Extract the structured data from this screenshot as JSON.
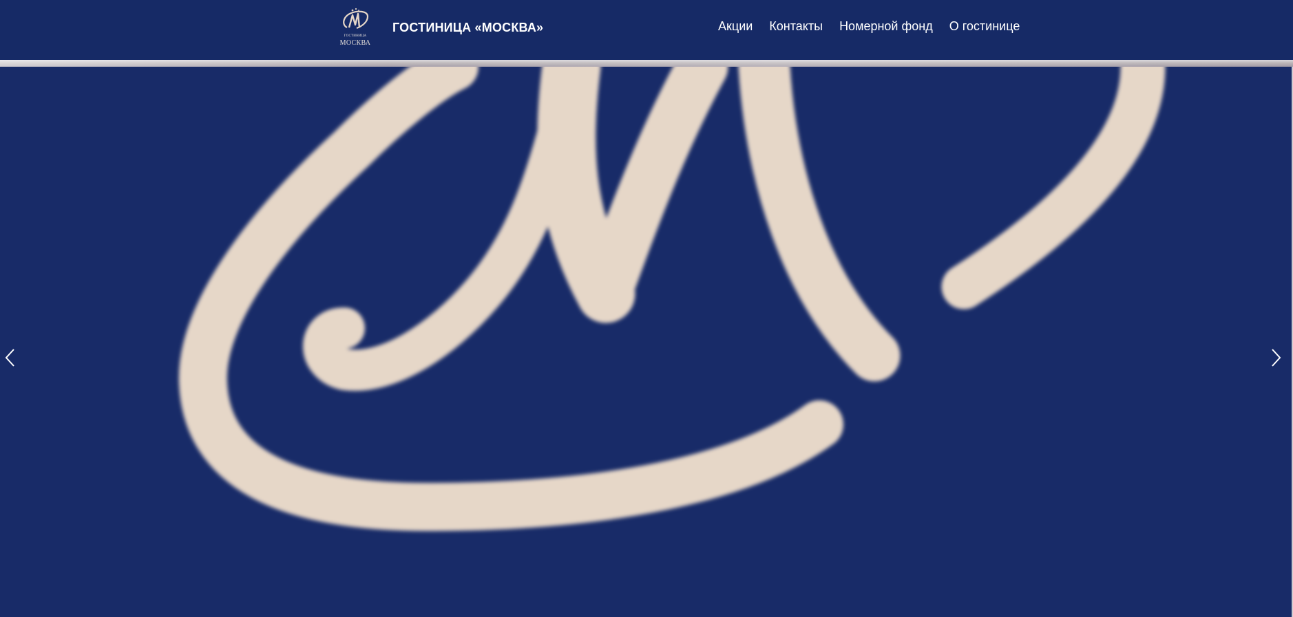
{
  "header": {
    "title": "ГОСТИНИЦА «МОСКВА»",
    "logo": {
      "small_text": "ГОСТИНИЦА",
      "name_text": "МОСКВА"
    },
    "nav": [
      {
        "label": "Акции"
      },
      {
        "label": "Контакты"
      },
      {
        "label": "Номерной фонд"
      },
      {
        "label": "О гостинице"
      }
    ]
  },
  "slider": {
    "prev_icon": "chevron-left-icon",
    "next_icon": "chevron-right-icon"
  },
  "colors": {
    "background": "#162a66",
    "logo_cream": "#e6d7c8",
    "text": "#ffffff"
  }
}
